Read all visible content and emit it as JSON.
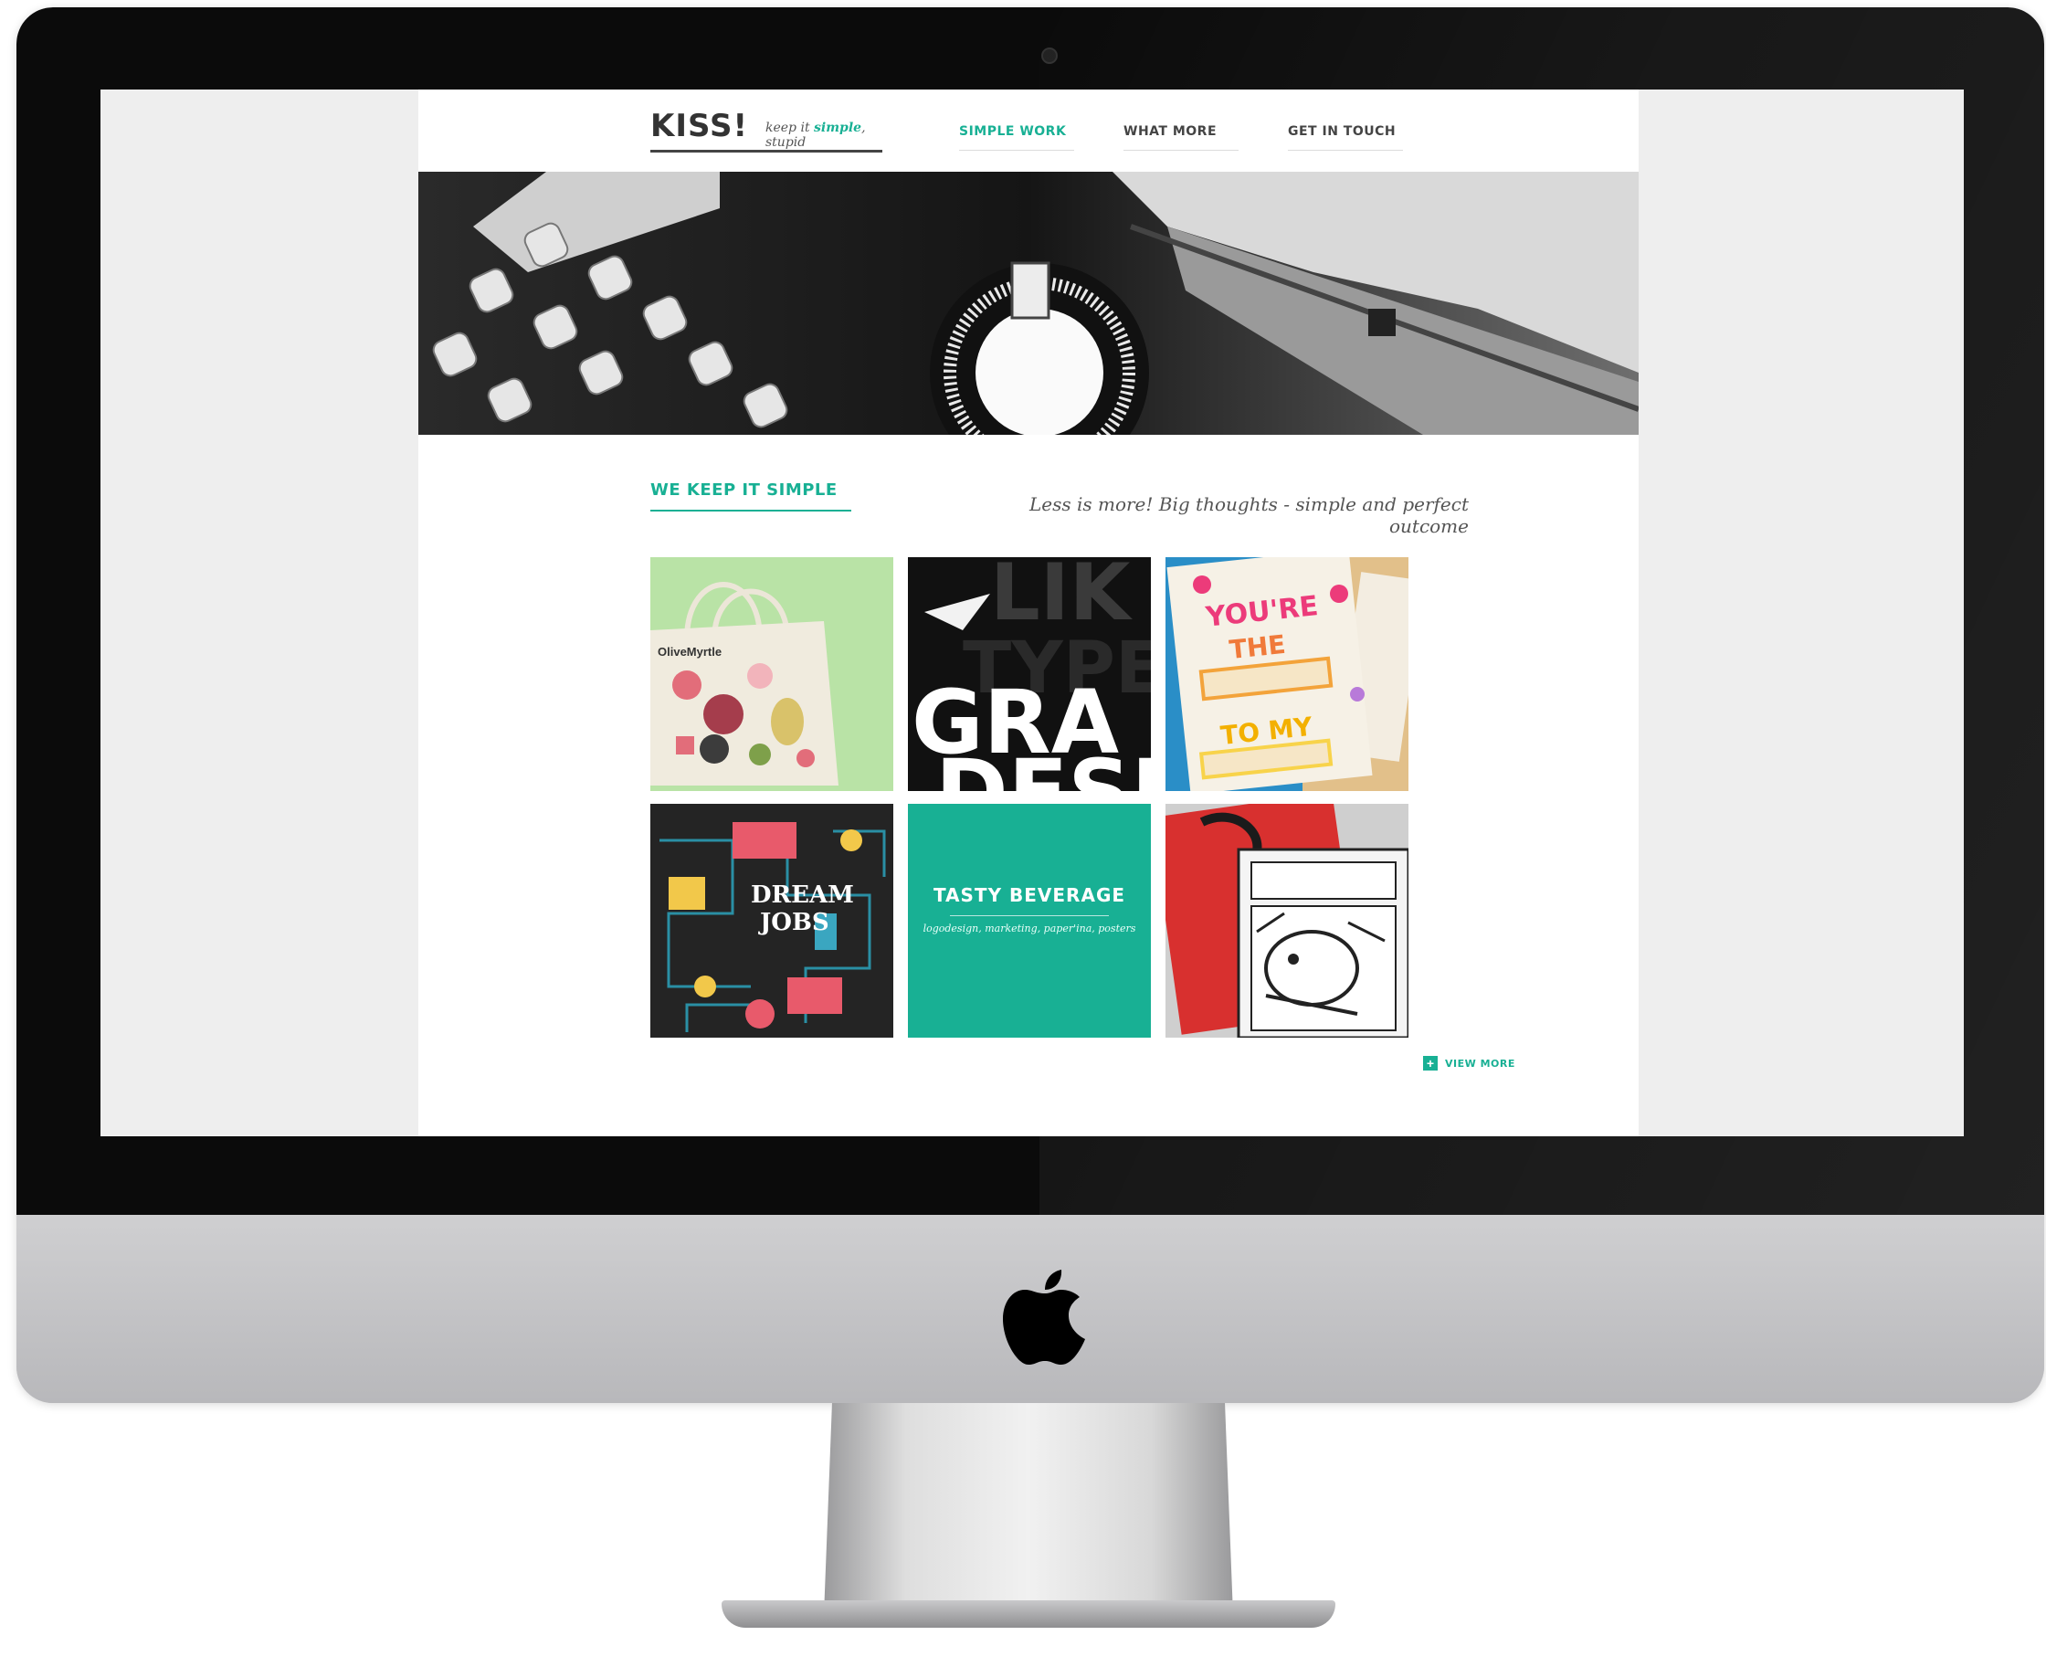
{
  "site": {
    "logo_mark": "KISS!",
    "logo_tag_pre": "keep it ",
    "logo_tag_highlight": "simple",
    "logo_tag_post": ", stupid"
  },
  "nav": {
    "items": [
      {
        "label": "SIMPLE WORK",
        "active": true
      },
      {
        "label": "WHAT MORE",
        "active": false
      },
      {
        "label": "GET IN TOUCH",
        "active": false
      }
    ]
  },
  "section": {
    "title": "WE KEEP IT SIMPLE",
    "tagline": "Less is more! Big thoughts - simple and perfect outcome"
  },
  "tiles": [
    {
      "image": "tote-bag-illustration",
      "text": "OliveMyrtle"
    },
    {
      "image": "typography-poster",
      "text_top": "LIK",
      "text_mid": "TYPE",
      "text_main": "GRA",
      "text_bottom": "DESI"
    },
    {
      "image": "letterpress-cards",
      "text_a": "YOU'RE",
      "text_b": "THE",
      "text_c": "TO MY"
    },
    {
      "image": "dream-jobs-illustration",
      "text_a": "DREAM",
      "text_b": "JOBS"
    },
    {
      "image": "tasty-beverage",
      "title": "TASTY BEVERAGE",
      "subtitle": "logodesign, marketing, paper'ina, posters"
    },
    {
      "image": "comic-zine"
    }
  ],
  "view_more": {
    "icon": "plus-icon",
    "label": "VIEW MORE"
  },
  "colors": {
    "accent": "#18b094",
    "bezel": "#0b0b0b",
    "screen_bg": "#eeeeee"
  }
}
